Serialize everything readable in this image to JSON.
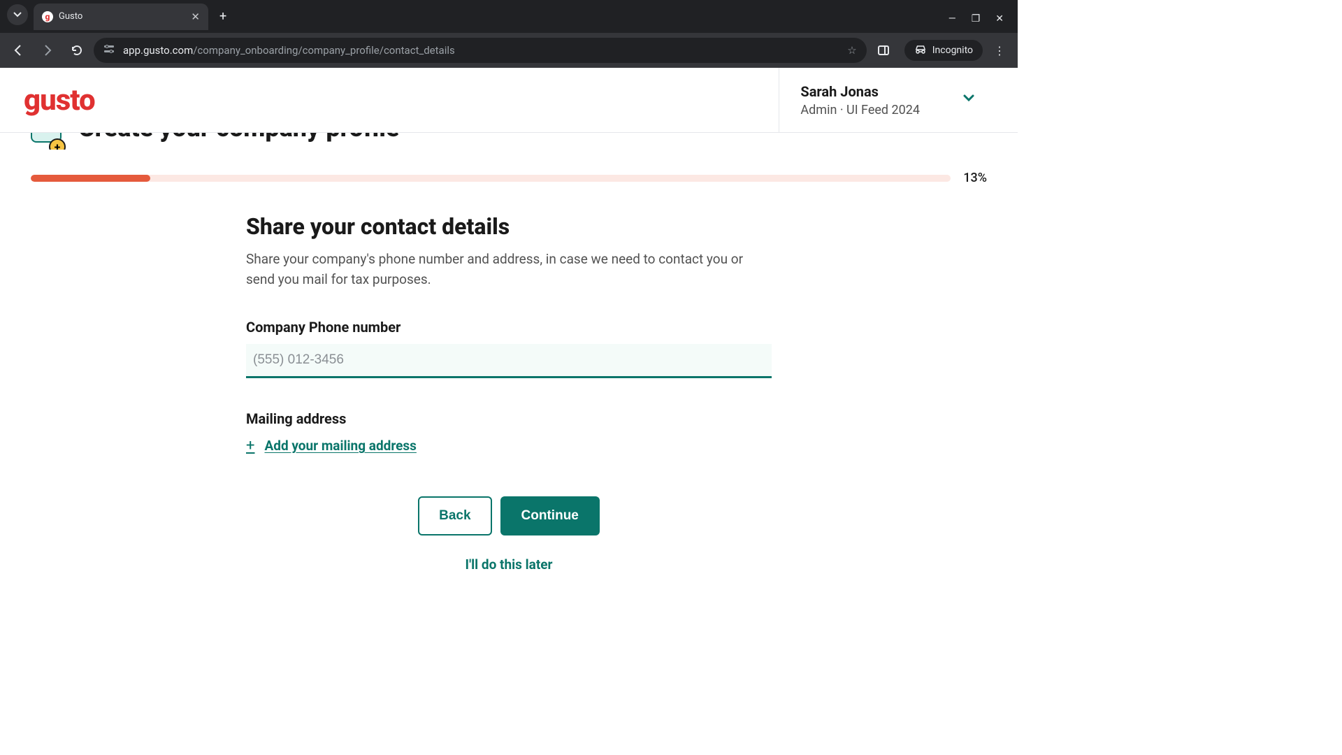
{
  "browser": {
    "tab_title": "Gusto",
    "url_host": "app.gusto.com",
    "url_path": "/company_onboarding/company_profile/contact_details",
    "incognito_label": "Incognito"
  },
  "header": {
    "logo_text": "gusto",
    "user_name": "Sarah Jonas",
    "user_role": "Admin · UI Feed 2024"
  },
  "section": {
    "title_cut": "Create your company profile",
    "progress_pct_label": "13%",
    "progress_pct": 13
  },
  "form": {
    "title": "Share your contact details",
    "description": "Share your company's phone number and address, in case we need to contact you or send you mail for tax purposes.",
    "phone_label": "Company Phone number",
    "phone_placeholder": "(555) 012-3456",
    "phone_value": "",
    "mailing_label": "Mailing address",
    "add_address_label": "Add your mailing address",
    "back_label": "Back",
    "continue_label": "Continue",
    "skip_label": "I'll do this later"
  },
  "colors": {
    "brand_teal": "#0a756a",
    "brand_red": "#e03131",
    "progress_fill": "#e55a3c",
    "progress_track": "#fce8e3"
  }
}
